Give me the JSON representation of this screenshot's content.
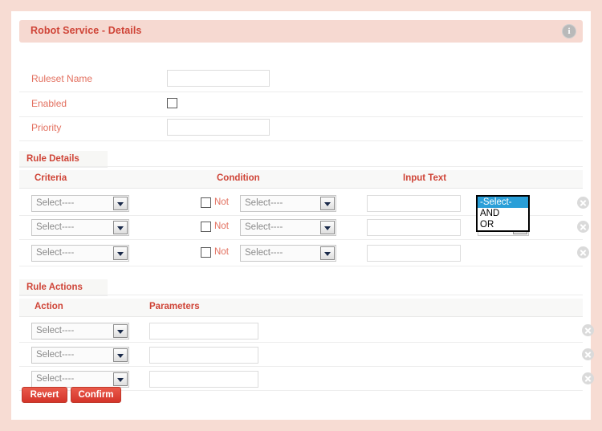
{
  "panel": {
    "title": "Robot Service - Details",
    "info_icon": "info-icon",
    "info_glyph": "i",
    "accent_color": "#cf4437",
    "header_bg": "#f6d9d1",
    "frame_bg": "#f7dcd3"
  },
  "form": {
    "fields": [
      {
        "label": "Ruleset Name",
        "type": "text",
        "value": "",
        "placeholder": ""
      },
      {
        "label": "Enabled",
        "type": "checkbox",
        "checked": false
      },
      {
        "label": "Priority",
        "type": "text",
        "value": "",
        "placeholder": ""
      }
    ]
  },
  "rule_details": {
    "section_title": "Rule Details",
    "columns": [
      "Criteria",
      "Condition",
      "Input Text"
    ],
    "not_label": "Not",
    "select_placeholder": "Select----",
    "rows": [
      {
        "criteria": "Select----",
        "not_checked": false,
        "condition": "Select----",
        "input_text": "",
        "operator": "-Select-",
        "delete_icon": "delete-circle-icon"
      },
      {
        "criteria": "Select----",
        "not_checked": false,
        "condition": "Select----",
        "input_text": "",
        "operator": "-Select-",
        "delete_icon": "delete-circle-icon"
      },
      {
        "criteria": "Select----",
        "not_checked": false,
        "condition": "Select----",
        "input_text": "",
        "operator": "",
        "delete_icon": "delete-circle-icon"
      }
    ],
    "open_dropdown": {
      "options": [
        "-Select-",
        "AND",
        "OR"
      ],
      "selected": "-Select-",
      "highlight_color": "#2a9fd8"
    }
  },
  "rule_actions": {
    "section_title": "Rule Actions",
    "columns": [
      "Action",
      "Parameters"
    ],
    "select_placeholder": "Select----",
    "rows": [
      {
        "action": "Select----",
        "parameters": "",
        "delete_icon": "delete-circle-icon"
      },
      {
        "action": "Select----",
        "parameters": "",
        "delete_icon": "delete-circle-icon"
      },
      {
        "action": "Select----",
        "parameters": "",
        "delete_icon": "delete-circle-icon"
      }
    ]
  },
  "footer": {
    "revert_label": "Revert",
    "confirm_label": "Confirm",
    "button_color": "#d4342a"
  }
}
